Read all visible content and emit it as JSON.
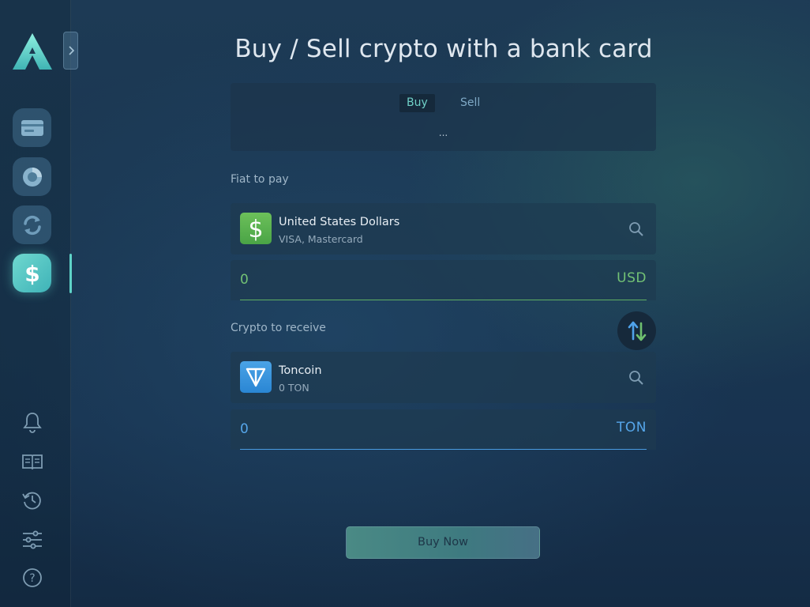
{
  "sidebar": {
    "nav_items": [
      {
        "name": "wallet",
        "icon": "card-icon"
      },
      {
        "name": "portfolio",
        "icon": "pie-chart-icon"
      },
      {
        "name": "exchange",
        "icon": "refresh-icon"
      },
      {
        "name": "buy-sell",
        "icon": "dollar-icon",
        "active": true
      }
    ],
    "tools": [
      {
        "name": "notifications",
        "icon": "bell-icon"
      },
      {
        "name": "address-book",
        "icon": "book-icon"
      },
      {
        "name": "history",
        "icon": "history-icon"
      },
      {
        "name": "settings",
        "icon": "sliders-icon"
      },
      {
        "name": "help",
        "icon": "help-icon"
      }
    ]
  },
  "page": {
    "title": "Buy / Sell crypto with a bank card",
    "mode_tabs": {
      "buy": "Buy",
      "sell": "Sell",
      "active": "Buy"
    },
    "mode_placeholder": "...",
    "fiat": {
      "label": "Fiat to pay",
      "name": "United States Dollars",
      "methods": "VISA, Mastercard",
      "amount": "0",
      "unit": "USD"
    },
    "crypto": {
      "label": "Crypto to receive",
      "name": "Toncoin",
      "balance": "0 TON",
      "amount": "0",
      "unit": "TON"
    },
    "submit_label": "Buy Now"
  },
  "colors": {
    "accent_teal": "#5fd3c8",
    "fiat_green": "#73c275",
    "crypto_blue": "#56a6ea"
  }
}
